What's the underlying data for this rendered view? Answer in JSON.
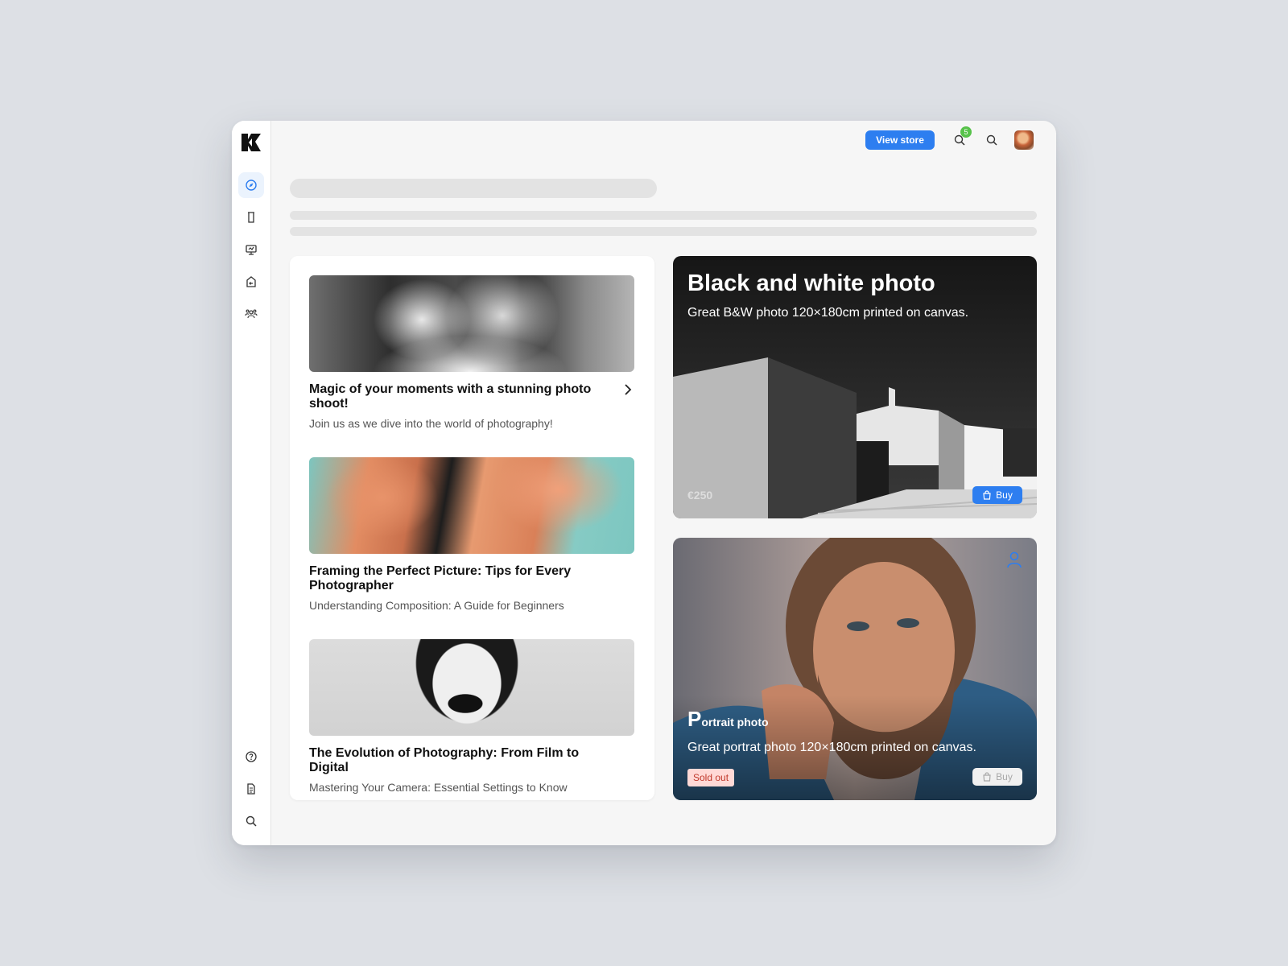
{
  "topbar": {
    "view_store_label": "View store",
    "notification_count": "5",
    "accent_color": "#2d7ef0",
    "badge_color": "#57c24a"
  },
  "sidebar": {
    "items": [
      {
        "icon": "compass-icon",
        "active": true
      },
      {
        "icon": "bookmark-icon"
      },
      {
        "icon": "presentation-icon"
      },
      {
        "icon": "import-icon"
      },
      {
        "icon": "team-icon"
      }
    ],
    "bottom_items": [
      {
        "icon": "help-icon"
      },
      {
        "icon": "document-icon"
      },
      {
        "icon": "search-icon"
      }
    ]
  },
  "articles": [
    {
      "title": "Magic of your moments with a stunning photo shoot!",
      "subtitle": "Join us as we dive into the world of photography!"
    },
    {
      "title": "Framing the Perfect Picture: Tips for Every Photographer",
      "subtitle": "Understanding Composition: A Guide for Beginners"
    },
    {
      "title": "The Evolution of Photography: From Film to Digital",
      "subtitle": "Mastering Your Camera: Essential Settings to Know"
    }
  ],
  "products": [
    {
      "title": "Black and white photo",
      "description": "Great B&W photo 120×180cm printed on canvas.",
      "price": "€250",
      "buy_label": "Buy"
    },
    {
      "title_initial": "P",
      "title_rest": "ortrait photo",
      "description": "Great portrat photo 120×180cm printed on canvas.",
      "status": "Sold out",
      "buy_label": "Buy",
      "status_color": "#c0392b"
    }
  ]
}
